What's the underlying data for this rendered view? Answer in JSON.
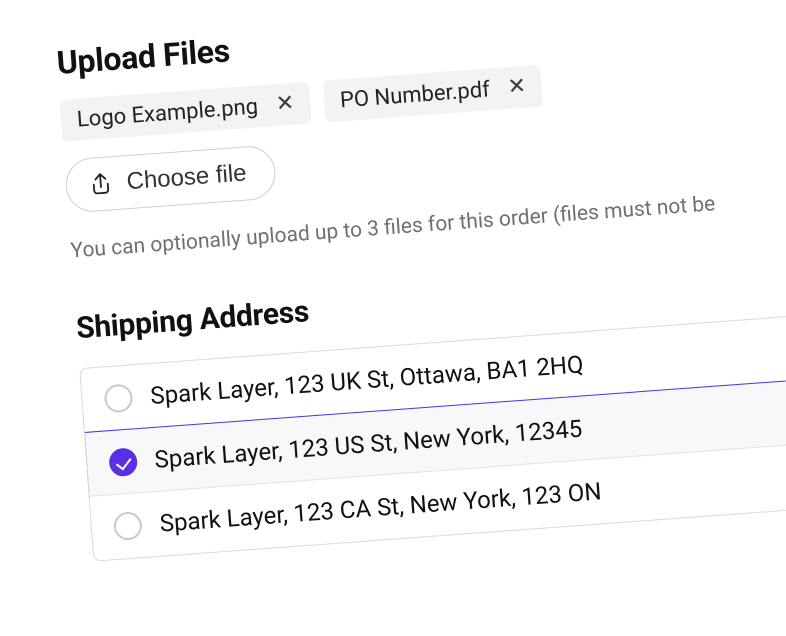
{
  "upload": {
    "title": "Upload Files",
    "files": [
      {
        "name": "Logo Example.png"
      },
      {
        "name": "PO Number.pdf"
      }
    ],
    "choose_label": "Choose file",
    "help_text": "You can optionally upload up to 3 files for this order (files must not be"
  },
  "shipping": {
    "title": "Shipping Address",
    "addresses": [
      {
        "label": "Spark Layer, 123 UK St, Ottawa, BA1 2HQ",
        "selected": false
      },
      {
        "label": "Spark Layer, 123 US St, New York, 12345",
        "selected": true
      },
      {
        "label": "Spark Layer, 123 CA St, New York, 123 ON",
        "selected": false
      }
    ]
  }
}
